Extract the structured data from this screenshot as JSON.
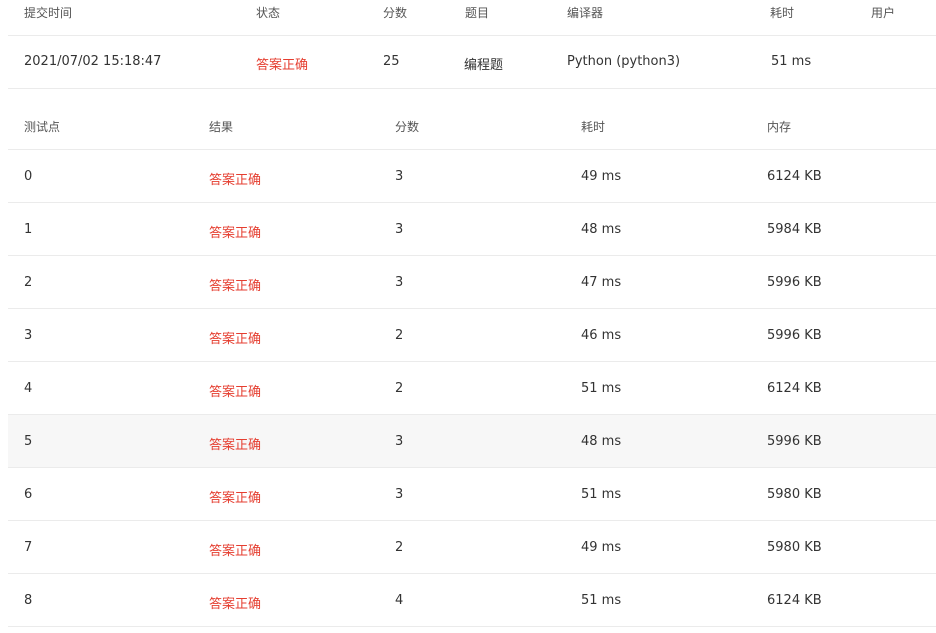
{
  "submission": {
    "headers": {
      "submit_time": "提交时间",
      "status": "状态",
      "score": "分数",
      "problem": "题目",
      "compiler": "编译器",
      "time": "耗时",
      "user": "用户"
    },
    "row": {
      "submit_time": "2021/07/02 15:18:47",
      "status": "答案正确",
      "score": "25",
      "problem": "编程题",
      "compiler": "Python (python3)",
      "time": "51 ms",
      "user": ""
    }
  },
  "testcases": {
    "headers": {
      "id": "测试点",
      "result": "结果",
      "score": "分数",
      "time": "耗时",
      "memory": "内存"
    },
    "rows": [
      {
        "id": "0",
        "result": "答案正确",
        "score": "3",
        "time": "49 ms",
        "memory": "6124 KB"
      },
      {
        "id": "1",
        "result": "答案正确",
        "score": "3",
        "time": "48 ms",
        "memory": "5984 KB"
      },
      {
        "id": "2",
        "result": "答案正确",
        "score": "3",
        "time": "47 ms",
        "memory": "5996 KB"
      },
      {
        "id": "3",
        "result": "答案正确",
        "score": "2",
        "time": "46 ms",
        "memory": "5996 KB"
      },
      {
        "id": "4",
        "result": "答案正确",
        "score": "2",
        "time": "51 ms",
        "memory": "6124 KB"
      },
      {
        "id": "5",
        "result": "答案正确",
        "score": "3",
        "time": "48 ms",
        "memory": "5996 KB"
      },
      {
        "id": "6",
        "result": "答案正确",
        "score": "3",
        "time": "51 ms",
        "memory": "5980 KB"
      },
      {
        "id": "7",
        "result": "答案正确",
        "score": "2",
        "time": "49 ms",
        "memory": "5980 KB"
      },
      {
        "id": "8",
        "result": "答案正确",
        "score": "4",
        "time": "51 ms",
        "memory": "6124 KB"
      }
    ],
    "highlighted_row": 5
  },
  "colors": {
    "accepted": "#e53e30",
    "divider": "#ebebeb",
    "hover_row": "#f7f7f7"
  }
}
